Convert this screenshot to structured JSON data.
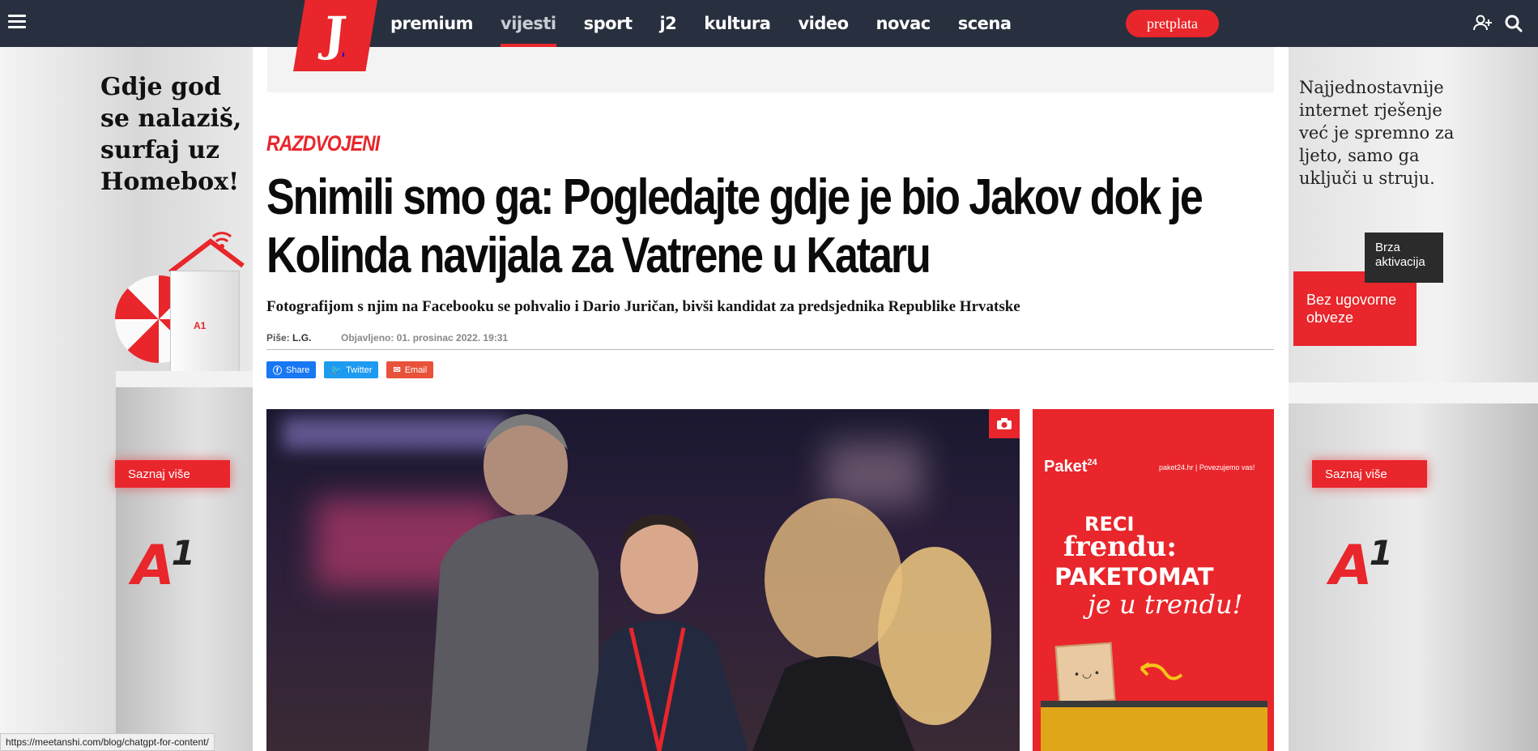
{
  "nav": {
    "logo": "J",
    "items": [
      {
        "label": "premium",
        "active": false
      },
      {
        "label": "vijesti",
        "active": true
      },
      {
        "label": "sport",
        "active": false
      },
      {
        "label": "j2",
        "active": false
      },
      {
        "label": "kultura",
        "active": false
      },
      {
        "label": "video",
        "active": false
      },
      {
        "label": "novac",
        "active": false
      },
      {
        "label": "scena",
        "active": false
      }
    ],
    "subscribe_label": "pretplata",
    "icons": [
      "hamburger-icon",
      "add-user-icon",
      "search-icon"
    ]
  },
  "ad_left": {
    "text": "Gdje god se nalaziš, surfaj uz Homebox!",
    "button": "Saznaj više",
    "brand": "A",
    "brand_sup": "1",
    "router_logo": "A1"
  },
  "ad_right": {
    "text": "Najjednostavnije internet rješenje već je spremno za ljeto, samo ga uključi u struju.",
    "badge_dark": "Brza aktivacija",
    "badge_red": "Bez ugovorne obveze",
    "button": "Saznaj više",
    "brand": "A",
    "brand_sup": "1"
  },
  "article": {
    "kicker": "RAZDVOJENI",
    "headline": "Snimili smo ga: Pogledajte gdje je bio Jakov dok je Kolinda navijala za Vatrene u Kataru",
    "subhead": "Fotografijom s njim na Facebooku se pohvalio i Dario Juričan, bivši kandidat za predsjednika Republike Hrvatske",
    "author_label": "Piše:",
    "author": "L.G.",
    "published": "Objavljeno: 01. prosinac 2022. 19:31",
    "share": {
      "facebook": "Share",
      "twitter": "Twitter",
      "email": "Email"
    }
  },
  "side_ad": {
    "brand": "Paket",
    "brand_sup": "24",
    "tagline": "paket24.hr | Povezujemo vas!",
    "line1": "RECI",
    "line2": "frendu:",
    "line3": "PAKETOMAT",
    "line4": "je u trendu!"
  },
  "status": {
    "url": "https://meetanshi.com/blog/chatgpt-for-content/"
  },
  "colors": {
    "brand_red": "#e8262b",
    "nav_bg": "#28303f"
  }
}
